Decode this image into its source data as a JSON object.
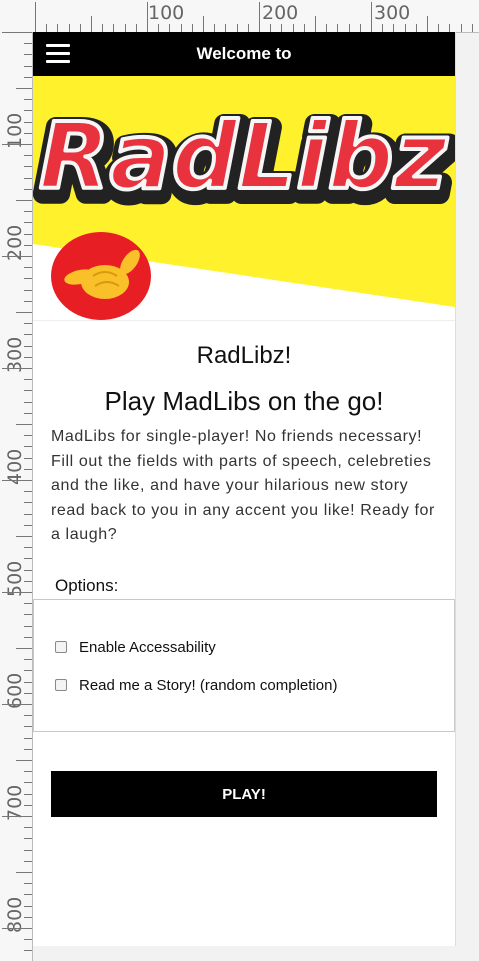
{
  "ruler": {
    "top_labels": [
      "100",
      "200",
      "300"
    ],
    "left_labels": [
      "100",
      "200",
      "300",
      "400",
      "500",
      "600",
      "700",
      "800"
    ]
  },
  "header": {
    "title": "Welcome to",
    "menu_icon": "hamburger-icon"
  },
  "hero": {
    "logo_text": "RadLibz",
    "badge_icon": "shaka-hand-icon",
    "colors": {
      "banner": "#fff12b",
      "logo": "#e8323d",
      "badge": "#e81e25"
    }
  },
  "main": {
    "title": "RadLibz!",
    "subtitle": "Play MadLibs on the go!",
    "description": "MadLibs for single-player! No friends necessary! Fill out the fields with parts of speech, celebreties and the like, and have your hilarious new story read back to you in any accent you like! Ready for a laugh?"
  },
  "options": {
    "legend": "Options:",
    "items": [
      {
        "label": "Enable Accessability",
        "checked": false
      },
      {
        "label": "Read me a Story! (random completion)",
        "checked": false
      }
    ]
  },
  "play_button": {
    "label": "PLAY!"
  }
}
